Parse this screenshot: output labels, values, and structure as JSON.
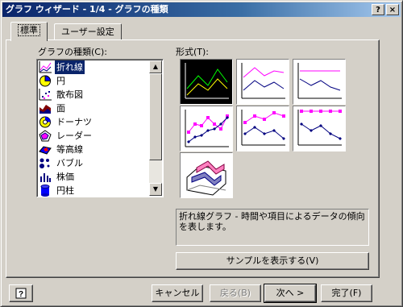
{
  "window": {
    "title": "グラフ ウィザード - 1/4 - グラフの種類",
    "help_button": "?",
    "close_button": "×"
  },
  "tabs": [
    {
      "label": "標準",
      "active": true
    },
    {
      "label": "ユーザー設定",
      "active": false
    }
  ],
  "chart_types": {
    "label": "グラフの種類(C):",
    "items": [
      {
        "label": "折れ線",
        "icon": "line-chart-icon",
        "selected": true
      },
      {
        "label": "円",
        "icon": "pie-chart-icon",
        "selected": false
      },
      {
        "label": "散布図",
        "icon": "scatter-chart-icon",
        "selected": false
      },
      {
        "label": "面",
        "icon": "area-chart-icon",
        "selected": false
      },
      {
        "label": "ドーナツ",
        "icon": "doughnut-chart-icon",
        "selected": false
      },
      {
        "label": "レーダー",
        "icon": "radar-chart-icon",
        "selected": false
      },
      {
        "label": "等高線",
        "icon": "surface-chart-icon",
        "selected": false
      },
      {
        "label": "バブル",
        "icon": "bubble-chart-icon",
        "selected": false
      },
      {
        "label": "株価",
        "icon": "stock-chart-icon",
        "selected": false
      },
      {
        "label": "円柱",
        "icon": "cylinder-chart-icon",
        "selected": false
      }
    ]
  },
  "subtypes": {
    "label": "形式(T):",
    "items": [
      {
        "name": "line",
        "selected": true
      },
      {
        "name": "stacked-line",
        "selected": false
      },
      {
        "name": "100-stacked-line",
        "selected": false
      },
      {
        "name": "line-with-markers",
        "selected": false
      },
      {
        "name": "stacked-line-with-markers",
        "selected": false
      },
      {
        "name": "100-stacked-line-with-markers",
        "selected": false
      },
      {
        "name": "3d-line",
        "selected": false
      }
    ]
  },
  "description": "折れ線グラフ - 時間や項目によるデータの傾向を表します。",
  "preview_button": "サンプルを表示する(V)",
  "footer": {
    "help_icon": "question-help-icon",
    "cancel": "キャンセル",
    "back": "戻る(B)",
    "next": "次へ >",
    "finish": "完了(F)"
  },
  "colors": {
    "title_start": "#0a246a",
    "title_end": "#a6caf0",
    "selection": "#0a246a",
    "face": "#d4d0c8",
    "series_magenta": "#ff00ff",
    "series_navy": "#000080",
    "series_green": "#00ff00"
  }
}
